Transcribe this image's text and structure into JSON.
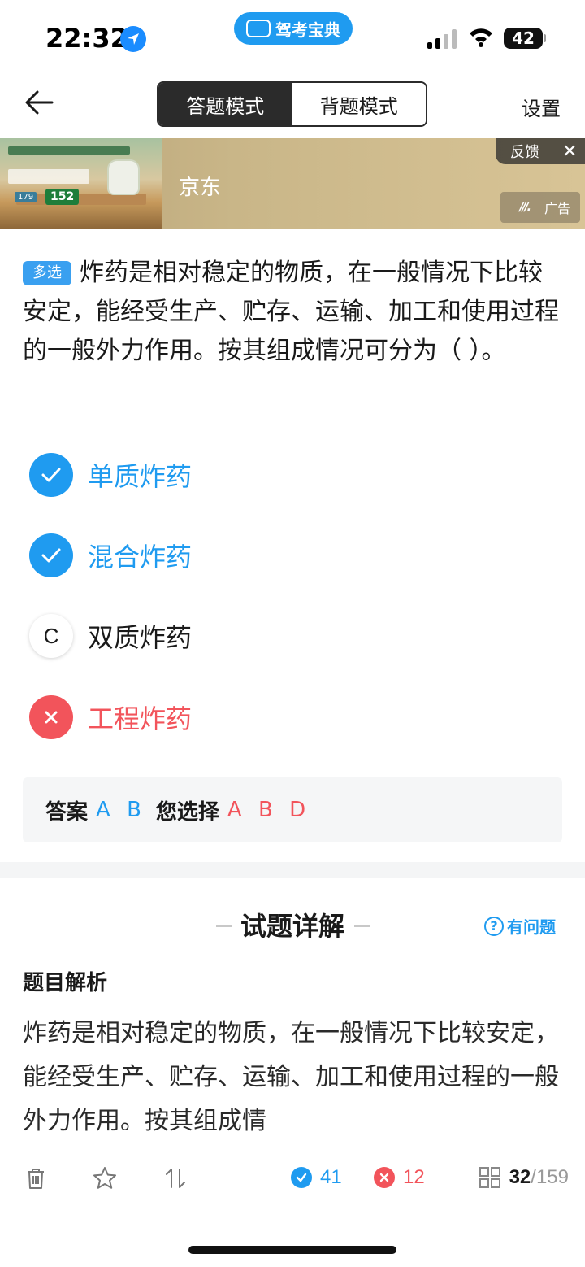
{
  "status_bar": {
    "time": "22:32",
    "app_pill": "驾考宝典",
    "battery": "42"
  },
  "nav": {
    "mode_answer": "答题模式",
    "mode_memorize": "背题模式",
    "active_mode": "答题模式",
    "settings": "设置"
  },
  "ad": {
    "title": "京东",
    "feedback": "反馈",
    "close": "✕",
    "badge": "广告",
    "image_price": "152",
    "image_old_price": "179"
  },
  "question": {
    "type": "多选",
    "text": "炸药是相对稳定的物质，在一般情况下比较安定，能经受生产、贮存、运输、加工和使用过程的一般外力作用。按其组成情况可分为（ ）。"
  },
  "options": [
    {
      "letter": "A",
      "label": "单质炸药",
      "state": "correct"
    },
    {
      "letter": "B",
      "label": "混合炸药",
      "state": "correct"
    },
    {
      "letter": "C",
      "label": "双质炸药",
      "state": "unselected"
    },
    {
      "letter": "D",
      "label": "工程炸药",
      "state": "wrong"
    }
  ],
  "answer": {
    "answer_label": "答案",
    "answer_value": "A B",
    "chosen_label": "您选择",
    "chosen_value": "A B D"
  },
  "explanation": {
    "title": "试题详解",
    "help": "有问题",
    "analysis_label": "题目解析",
    "analysis_text": "炸药是相对稳定的物质，在一般情况下比较安定，能经受生产、贮存、运输、加工和使用过程的一般外力作用。按其组成情"
  },
  "toolbar": {
    "correct_count": "41",
    "wrong_count": "12",
    "current": "32",
    "total": "/159"
  },
  "colors": {
    "accent_blue": "#1f9bf0",
    "error_red": "#f2545b",
    "dark": "#2b2b2b"
  }
}
